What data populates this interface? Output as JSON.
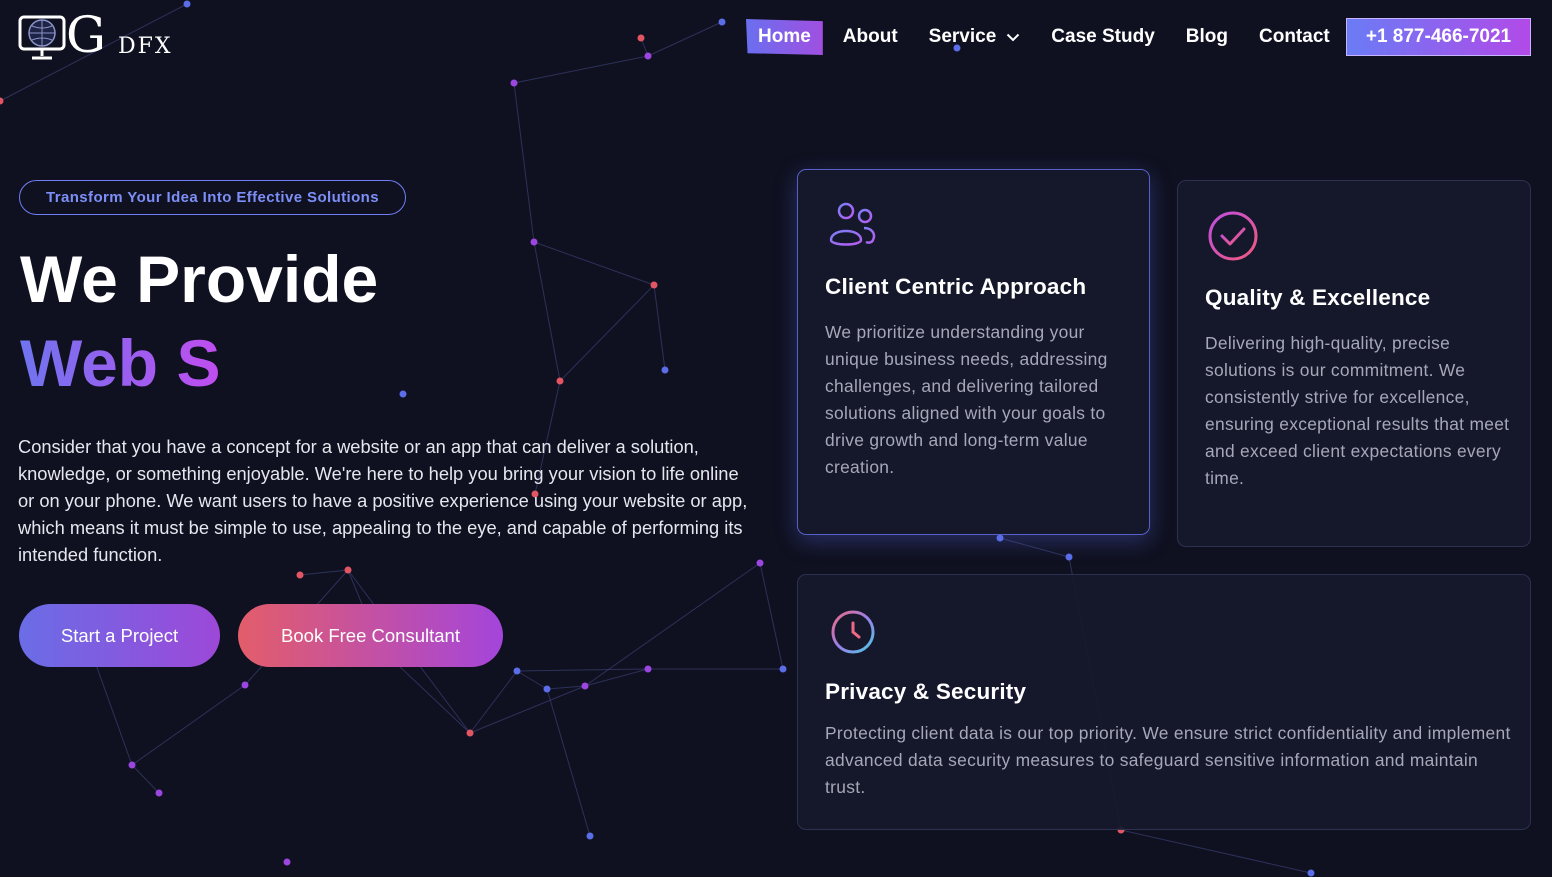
{
  "brand": {
    "logo_big": "G",
    "logo_small": "DFX"
  },
  "nav": {
    "items": [
      {
        "label": "Home",
        "active": true
      },
      {
        "label": "About"
      },
      {
        "label": "Service",
        "has_dropdown": true
      },
      {
        "label": "Case Study"
      },
      {
        "label": "Blog"
      },
      {
        "label": "Contact"
      }
    ],
    "phone": "+1 877-466-7021"
  },
  "hero": {
    "tagline": "Transform Your Idea Into Effective Solutions",
    "heading_line1": "We Provide",
    "heading_line2": "Web S",
    "description": "Consider that you have a concept for a website or an app that can deliver a solution, knowledge, or something enjoyable. We're here to help you bring your vision to life online or on your phone. We want users to have a positive experience using your website or app, which means it must be simple to use, appealing to the eye, and capable of performing its intended function.",
    "primary_cta": "Start a Project",
    "secondary_cta": "Book Free Consultant"
  },
  "features": [
    {
      "icon": "users-icon",
      "title": "Client Centric Approach",
      "description": "We prioritize understanding your unique business needs, addressing challenges, and delivering tailored solutions aligned with your goals to drive growth and long-term value creation."
    },
    {
      "icon": "check-circle-icon",
      "title": "Quality & Excellence",
      "description": "Delivering high-quality, precise solutions is our commitment. We consistently strive for excellence, ensuring exceptional results that meet and exceed client expectations every time."
    },
    {
      "icon": "clock-icon",
      "title": "Privacy & Security",
      "description": "Protecting client data is our top priority. We ensure strict confidentiality and implement advanced data security measures to safeguard sensitive information and maintain trust."
    }
  ],
  "colors": {
    "background": "#0f1120",
    "accent_blue": "#6a6ff0",
    "accent_purple": "#b24ae8",
    "accent_red": "#e35d6a",
    "card_text": "#a6a8b9"
  }
}
